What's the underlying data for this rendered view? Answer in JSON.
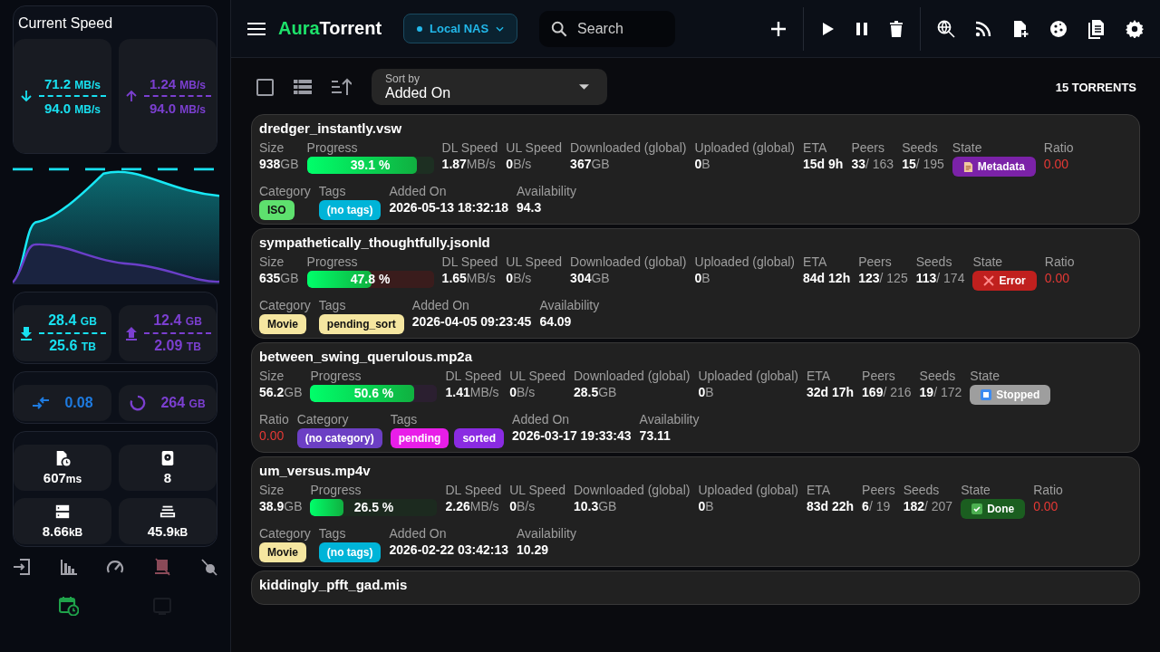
{
  "sidebar": {
    "speed": {
      "title": "Current Speed",
      "down": {
        "value": "71.2",
        "unit": "MB/s",
        "limit": "94.0",
        "limit_unit": "MB/s"
      },
      "up": {
        "value": "1.24",
        "unit": "MB/s",
        "limit": "94.0",
        "limit_unit": "MB/s"
      }
    },
    "totals": {
      "down": {
        "session": "28.4",
        "session_unit": "GB",
        "all": "25.6",
        "all_unit": "TB"
      },
      "up": {
        "session": "12.4",
        "session_unit": "GB",
        "all": "2.09",
        "all_unit": "TB"
      }
    },
    "ratio": "0.08",
    "free_space": {
      "value": "264",
      "unit": "GB"
    },
    "stats": [
      {
        "kind": "file-clock",
        "value": "607",
        "unit": "ms"
      },
      {
        "kind": "disk",
        "value": "8"
      },
      {
        "kind": "server",
        "value": "8.66",
        "unit": "kB"
      },
      {
        "kind": "stack",
        "value": "45.9",
        "unit": "kB"
      }
    ]
  },
  "topbar": {
    "logo": {
      "first": "Aura",
      "second": "Torrent"
    },
    "server": "Local NAS",
    "search": {
      "placeholder": "Search"
    }
  },
  "toolbar": {
    "select_all": {
      "checked": false
    },
    "sort_label": "Sort by",
    "sort_value": "Added On",
    "count": "15 TORRENTS"
  },
  "torrents": [
    {
      "name": "dredger_instantly.vsw",
      "lines": [
        [
          {
            "label": "Size",
            "kind": "text",
            "value": "938",
            "unit": "GB"
          },
          {
            "label": "Progress",
            "kind": "progress",
            "level": 0.87,
            "text": "39.1 %"
          },
          {
            "label": "DL Speed",
            "kind": "text",
            "value": "1.87",
            "unit": "MB/s"
          },
          {
            "label": "UL Speed",
            "kind": "text",
            "value": "0",
            "unit": "B/s"
          },
          {
            "label": "Downloaded (global)",
            "kind": "text",
            "value": "367",
            "unit": "GB"
          },
          {
            "label": "Uploaded (global)",
            "kind": "text",
            "value": "0",
            "unit": "B"
          },
          {
            "label": "ETA",
            "kind": "text",
            "value": "15d 9h"
          },
          {
            "label": "Peers",
            "kind": "text",
            "value": "33",
            "unit": "/ 163"
          },
          {
            "label": "Seeds",
            "kind": "text",
            "value": "15",
            "unit": "/ 195"
          },
          {
            "label": "State",
            "kind": "state",
            "badge": {
              "kind": "metadata",
              "text": "Metadata"
            }
          },
          {
            "label": "Ratio",
            "kind": "ratio",
            "value": "0.00"
          }
        ],
        [
          {
            "label": "Category",
            "kind": "chips",
            "chips": [
              {
                "label": "ISO",
                "color": "#5ee06e"
              }
            ]
          },
          {
            "label": "Tags",
            "kind": "chips",
            "chips": [
              {
                "label": "(no tags)",
                "color": "#00b4d8"
              }
            ]
          },
          {
            "label": "Added On",
            "kind": "text",
            "value": "2026-05-13 18:32:18"
          },
          {
            "label": "Availability",
            "kind": "text",
            "value": "94.3"
          }
        ]
      ]
    },
    {
      "name": "sympathetically_thoughtfully.jsonld",
      "lines": [
        [
          {
            "label": "Size",
            "kind": "text",
            "value": "635",
            "unit": "GB"
          },
          {
            "label": "Progress",
            "kind": "progress",
            "level": 0.51,
            "text": "47.8 %"
          },
          {
            "label": "DL Speed",
            "kind": "text",
            "value": "1.65",
            "unit": "MB/s"
          },
          {
            "label": "UL Speed",
            "kind": "text",
            "value": "0",
            "unit": "B/s"
          },
          {
            "label": "Downloaded (global)",
            "kind": "text",
            "value": "304",
            "unit": "GB"
          },
          {
            "label": "Uploaded (global)",
            "kind": "text",
            "value": "0",
            "unit": "B"
          },
          {
            "label": "ETA",
            "kind": "text",
            "value": "84d 12h"
          },
          {
            "label": "Peers",
            "kind": "text",
            "value": "123",
            "unit": "/ 125"
          },
          {
            "label": "Seeds",
            "kind": "text",
            "value": "113",
            "unit": "/ 174"
          },
          {
            "label": "State",
            "kind": "state",
            "badge": {
              "kind": "error",
              "text": "Error"
            }
          },
          {
            "label": "Ratio",
            "kind": "ratio",
            "value": "0.00"
          }
        ],
        [
          {
            "label": "Category",
            "kind": "chips",
            "chips": [
              {
                "label": "Movie",
                "color": "#f5e6a0"
              }
            ]
          },
          {
            "label": "Tags",
            "kind": "chips",
            "chips": [
              {
                "label": "pending_sort",
                "color": "#f5e6a0"
              }
            ]
          },
          {
            "label": "Added On",
            "kind": "text",
            "value": "2026-04-05 09:23:45"
          },
          {
            "label": "Availability",
            "kind": "text",
            "value": "64.09"
          }
        ]
      ]
    },
    {
      "name": "between_swing_querulous.mp2a",
      "lines": [
        [
          {
            "label": "Size",
            "kind": "text",
            "value": "56.2",
            "unit": "GB"
          },
          {
            "label": "Progress",
            "kind": "progress",
            "level": 0.82,
            "text": "50.6 %"
          },
          {
            "label": "DL Speed",
            "kind": "text",
            "value": "1.41",
            "unit": "MB/s"
          },
          {
            "label": "UL Speed",
            "kind": "text",
            "value": "0",
            "unit": "B/s"
          },
          {
            "label": "Downloaded (global)",
            "kind": "text",
            "value": "28.5",
            "unit": "GB"
          },
          {
            "label": "Uploaded (global)",
            "kind": "text",
            "value": "0",
            "unit": "B"
          },
          {
            "label": "ETA",
            "kind": "text",
            "value": "32d 17h"
          },
          {
            "label": "Peers",
            "kind": "text",
            "value": "169",
            "unit": "/ 216"
          },
          {
            "label": "Seeds",
            "kind": "text",
            "value": "19",
            "unit": "/ 172"
          },
          {
            "label": "State",
            "kind": "state",
            "badge": {
              "kind": "stopped",
              "text": "Stopped"
            }
          }
        ],
        [
          {
            "label": "Ratio",
            "kind": "ratio",
            "value": "0.00"
          },
          {
            "label": "Category",
            "kind": "chips",
            "chips": [
              {
                "label": "(no category)",
                "color": "#6c3fc4"
              }
            ]
          },
          {
            "label": "Tags",
            "kind": "chips",
            "chips": [
              {
                "label": "pending",
                "color": "#e81ee8"
              },
              {
                "label": "sorted",
                "color": "#8a2be2"
              }
            ]
          },
          {
            "label": "Added On",
            "kind": "text",
            "value": "2026-03-17 19:33:43"
          },
          {
            "label": "Availability",
            "kind": "text",
            "value": "73.11"
          }
        ]
      ]
    },
    {
      "name": "um_versus.mp4v",
      "lines": [
        [
          {
            "label": "Size",
            "kind": "text",
            "value": "38.9",
            "unit": "GB"
          },
          {
            "label": "Progress",
            "kind": "progress",
            "level": 0.26,
            "text": "26.5 %"
          },
          {
            "label": "DL Speed",
            "kind": "text",
            "value": "2.26",
            "unit": "MB/s"
          },
          {
            "label": "UL Speed",
            "kind": "text",
            "value": "0",
            "unit": "B/s"
          },
          {
            "label": "Downloaded (global)",
            "kind": "text",
            "value": "10.3",
            "unit": "GB"
          },
          {
            "label": "Uploaded (global)",
            "kind": "text",
            "value": "0",
            "unit": "B"
          },
          {
            "label": "ETA",
            "kind": "text",
            "value": "83d 22h"
          },
          {
            "label": "Peers",
            "kind": "text",
            "value": "6",
            "unit": "/ 19"
          },
          {
            "label": "Seeds",
            "kind": "text",
            "value": "182",
            "unit": "/ 207"
          },
          {
            "label": "State",
            "kind": "state",
            "badge": {
              "kind": "done",
              "text": "Done"
            }
          },
          {
            "label": "Ratio",
            "kind": "ratio",
            "value": "0.00"
          }
        ],
        [
          {
            "label": "Category",
            "kind": "chips",
            "chips": [
              {
                "label": "Movie",
                "color": "#f5e6a0"
              }
            ]
          },
          {
            "label": "Tags",
            "kind": "chips",
            "chips": [
              {
                "label": "(no tags)",
                "color": "#00b4d8"
              }
            ]
          },
          {
            "label": "Added On",
            "kind": "text",
            "value": "2026-02-22 03:42:13"
          },
          {
            "label": "Availability",
            "kind": "text",
            "value": "10.29"
          }
        ]
      ]
    },
    {
      "name": "kiddingly_pfft_gad.mis"
    }
  ]
}
